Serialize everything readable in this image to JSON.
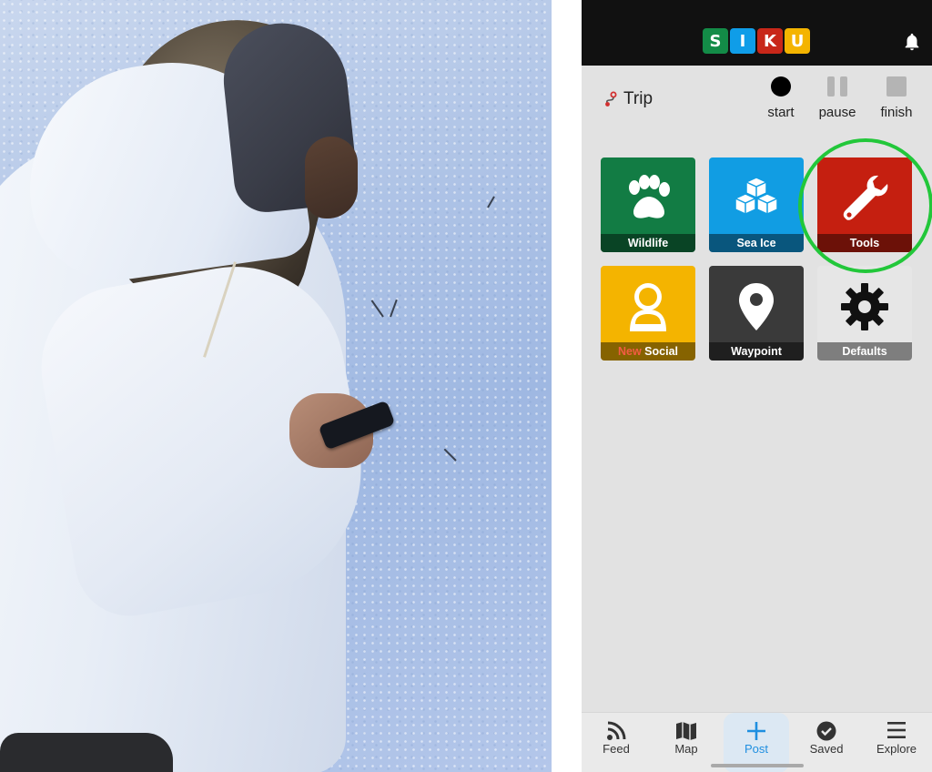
{
  "app": {
    "logo_letters": [
      "S",
      "I",
      "K",
      "U"
    ],
    "logo_colors": [
      "#138b47",
      "#0f9de8",
      "#c82719",
      "#f4b400"
    ]
  },
  "icons": {
    "notifications": "bell-icon",
    "trip": "route-icon"
  },
  "trip": {
    "label": "Trip",
    "controls": [
      {
        "label": "start",
        "icon": "record-icon"
      },
      {
        "label": "pause",
        "icon": "pause-icon"
      },
      {
        "label": "finish",
        "icon": "stop-icon"
      }
    ]
  },
  "tiles": [
    {
      "label": "Wildlife",
      "icon": "paw-icon",
      "color": "#127c44"
    },
    {
      "label": "Sea Ice",
      "icon": "ice-blocks-icon",
      "color": "#119de3"
    },
    {
      "label": "Tools",
      "icon": "wrench-icon",
      "color": "#c51f10",
      "highlighted": true
    },
    {
      "label_prefix": "New",
      "label": "Social",
      "icon": "social-person-icon",
      "color": "#f4b400"
    },
    {
      "label": "Waypoint",
      "icon": "map-pin-icon",
      "color": "#3a3a3a"
    },
    {
      "label": "Defaults",
      "icon": "gear-icon",
      "color": "#e6e6e6"
    }
  ],
  "highlight_color": "#22c73a",
  "bottom_nav": [
    {
      "label": "Feed",
      "icon": "rss-icon"
    },
    {
      "label": "Map",
      "icon": "map-icon"
    },
    {
      "label": "Post",
      "icon": "plus-icon",
      "active": true
    },
    {
      "label": "Saved",
      "icon": "check-circle-icon"
    },
    {
      "label": "Explore",
      "icon": "menu-icon"
    }
  ],
  "accent_color": "#1f8fe0"
}
